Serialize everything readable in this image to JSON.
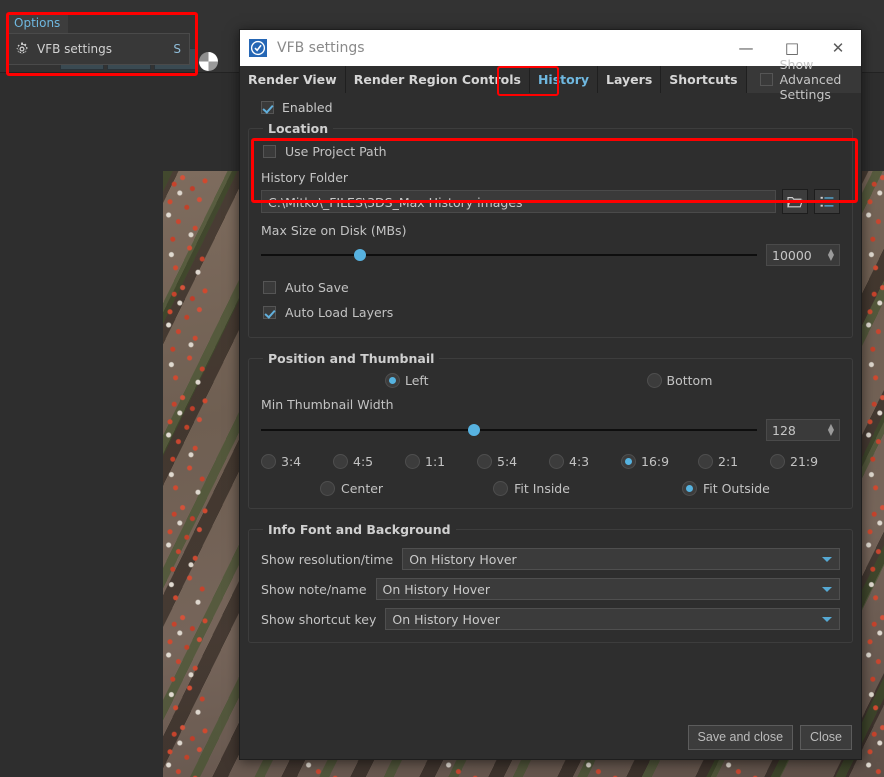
{
  "options_menu": {
    "title": "Options",
    "items": [
      {
        "label": "VFB settings",
        "shortcut": "S",
        "icon": "gear-icon"
      }
    ]
  },
  "dialog": {
    "title": "VFB settings",
    "logo_icon": "vray-logo-icon",
    "window_controls": {
      "minimize": "—",
      "maximize": "□",
      "close": "✕"
    },
    "tabs": [
      {
        "label": "Render View",
        "active": false
      },
      {
        "label": "Render Region Controls",
        "active": false
      },
      {
        "label": "History",
        "active": true
      },
      {
        "label": "Layers",
        "active": false
      },
      {
        "label": "Shortcuts",
        "active": false
      }
    ],
    "advanced": {
      "label": "Show Advanced Settings",
      "checked": false
    },
    "enabled": {
      "label": "Enabled",
      "checked": true
    },
    "location": {
      "legend": "Location",
      "use_project_path": {
        "label": "Use Project Path",
        "checked": false
      },
      "history_folder_label": "History Folder",
      "history_folder_value": "C:\\Mitko\\_FILES\\3DS_Max History images",
      "browse_icon": "folder-open-icon",
      "list_icon": "list-view-icon",
      "max_size_label": "Max Size on Disk (MBs)",
      "max_size_value": "10000",
      "max_size_knob_pct": 20,
      "auto_save": {
        "label": "Auto Save",
        "checked": false
      },
      "auto_load_layers": {
        "label": "Auto Load Layers",
        "checked": true
      }
    },
    "position_thumbnail": {
      "legend": "Position and Thumbnail",
      "position_options": [
        {
          "label": "Left",
          "checked": true
        },
        {
          "label": "Bottom",
          "checked": false
        }
      ],
      "min_thumbnail_label": "Min Thumbnail Width",
      "min_thumbnail_value": "128",
      "min_thumbnail_knob_pct": 43,
      "ratios": [
        {
          "label": "3:4",
          "checked": false
        },
        {
          "label": "4:5",
          "checked": false
        },
        {
          "label": "1:1",
          "checked": false
        },
        {
          "label": "5:4",
          "checked": false
        },
        {
          "label": "4:3",
          "checked": false
        },
        {
          "label": "16:9",
          "checked": true
        },
        {
          "label": "2:1",
          "checked": false
        },
        {
          "label": "21:9",
          "checked": false
        }
      ],
      "fit_options": [
        {
          "label": "Center",
          "checked": false
        },
        {
          "label": "Fit Inside",
          "checked": false
        },
        {
          "label": "Fit Outside",
          "checked": true
        }
      ]
    },
    "info_font": {
      "legend": "Info Font and Background",
      "rows": [
        {
          "label": "Show resolution/time",
          "value": "On History Hover"
        },
        {
          "label": "Show note/name",
          "value": "On History Hover"
        },
        {
          "label": "Show shortcut key",
          "value": "On History Hover"
        }
      ]
    },
    "footer": {
      "save_and_close": "Save and close",
      "close": "Close"
    }
  },
  "colors": {
    "accent": "#56b3e0",
    "highlight": "#ff0000",
    "titlebar_bg": "#ffffff",
    "dialog_bg": "#2e2e2e"
  }
}
